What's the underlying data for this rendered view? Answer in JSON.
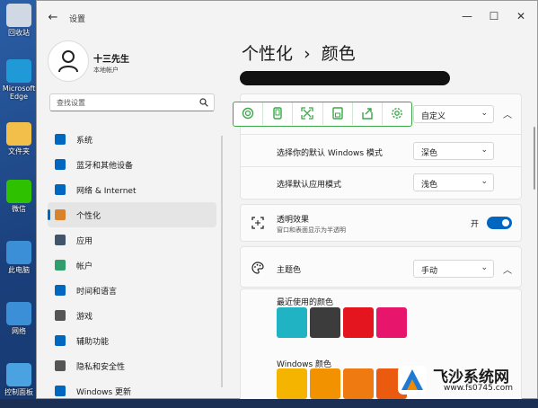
{
  "desktop": {
    "icons": [
      {
        "name": "recycle-bin",
        "label": "回收站",
        "color": "#cfd8e3"
      },
      {
        "name": "edge",
        "label": "Microsoft Edge",
        "color": "#1f9ad6"
      },
      {
        "name": "folder",
        "label": "文件夹",
        "color": "#f2c04a"
      },
      {
        "name": "wechat",
        "label": "微信",
        "color": "#2dc100"
      },
      {
        "name": "this-pc",
        "label": "此电脑",
        "color": "#3b8fd6"
      },
      {
        "name": "network",
        "label": "网络",
        "color": "#3b8fd6"
      },
      {
        "name": "control-panel",
        "label": "控制面板",
        "color": "#4aa3e0"
      }
    ]
  },
  "window": {
    "title": "设置",
    "controls": {
      "minimize": "—",
      "maximize": "☐",
      "close": "✕"
    }
  },
  "profile": {
    "name": "十三先生",
    "account_type": "本地帐户"
  },
  "search": {
    "placeholder": "查找设置"
  },
  "nav": {
    "items": [
      {
        "label": "系统",
        "icon": "monitor-icon",
        "color": "#0067c0",
        "active": false
      },
      {
        "label": "蓝牙和其他设备",
        "icon": "bluetooth-icon",
        "color": "#0067c0",
        "active": false
      },
      {
        "label": "网络 & Internet",
        "icon": "wifi-icon",
        "color": "#0067c0",
        "active": false
      },
      {
        "label": "个性化",
        "icon": "brush-icon",
        "color": "#d9822b",
        "active": true
      },
      {
        "label": "应用",
        "icon": "apps-icon",
        "color": "#40546b",
        "active": false
      },
      {
        "label": "帐户",
        "icon": "account-icon",
        "color": "#2f9e6b",
        "active": false
      },
      {
        "label": "时间和语言",
        "icon": "globe-clock-icon",
        "color": "#0067c0",
        "active": false
      },
      {
        "label": "游戏",
        "icon": "gamepad-icon",
        "color": "#555555",
        "active": false
      },
      {
        "label": "辅助功能",
        "icon": "accessibility-icon",
        "color": "#0067c0",
        "active": false
      },
      {
        "label": "隐私和安全性",
        "icon": "shield-icon",
        "color": "#555555",
        "active": false
      },
      {
        "label": "Windows 更新",
        "icon": "update-icon",
        "color": "#0067c0",
        "active": false
      }
    ]
  },
  "breadcrumb": {
    "parent": "个性化",
    "separator": "›",
    "current": "颜色"
  },
  "mode": {
    "select_value": "自定义",
    "windows_mode_label": "选择你的默认 Windows 模式",
    "windows_mode_value": "深色",
    "app_mode_label": "选择默认应用模式",
    "app_mode_value": "浅色"
  },
  "transparency": {
    "title": "透明效果",
    "subtitle": "窗口和表面显示为半透明",
    "state_label": "开",
    "on": true
  },
  "accent": {
    "title": "主题色",
    "select_value": "手动",
    "recent_label": "最近使用的颜色",
    "recent_colors": [
      "#1fb3c4",
      "#3c3c3c",
      "#e4151f",
      "#e8156c"
    ],
    "windows_label": "Windows 颜色",
    "windows_colors": [
      "#f5b400",
      "#f39200",
      "#ef7a12",
      "#ea5b10"
    ]
  },
  "toolbar": {
    "buttons": [
      "ocr-icon",
      "phone-icon",
      "expand-icon",
      "save-icon",
      "share-icon",
      "gear-icon"
    ],
    "accent": "#3aa847"
  },
  "watermark": {
    "title": "飞沙系统网",
    "url": "www.fs0745.com"
  }
}
